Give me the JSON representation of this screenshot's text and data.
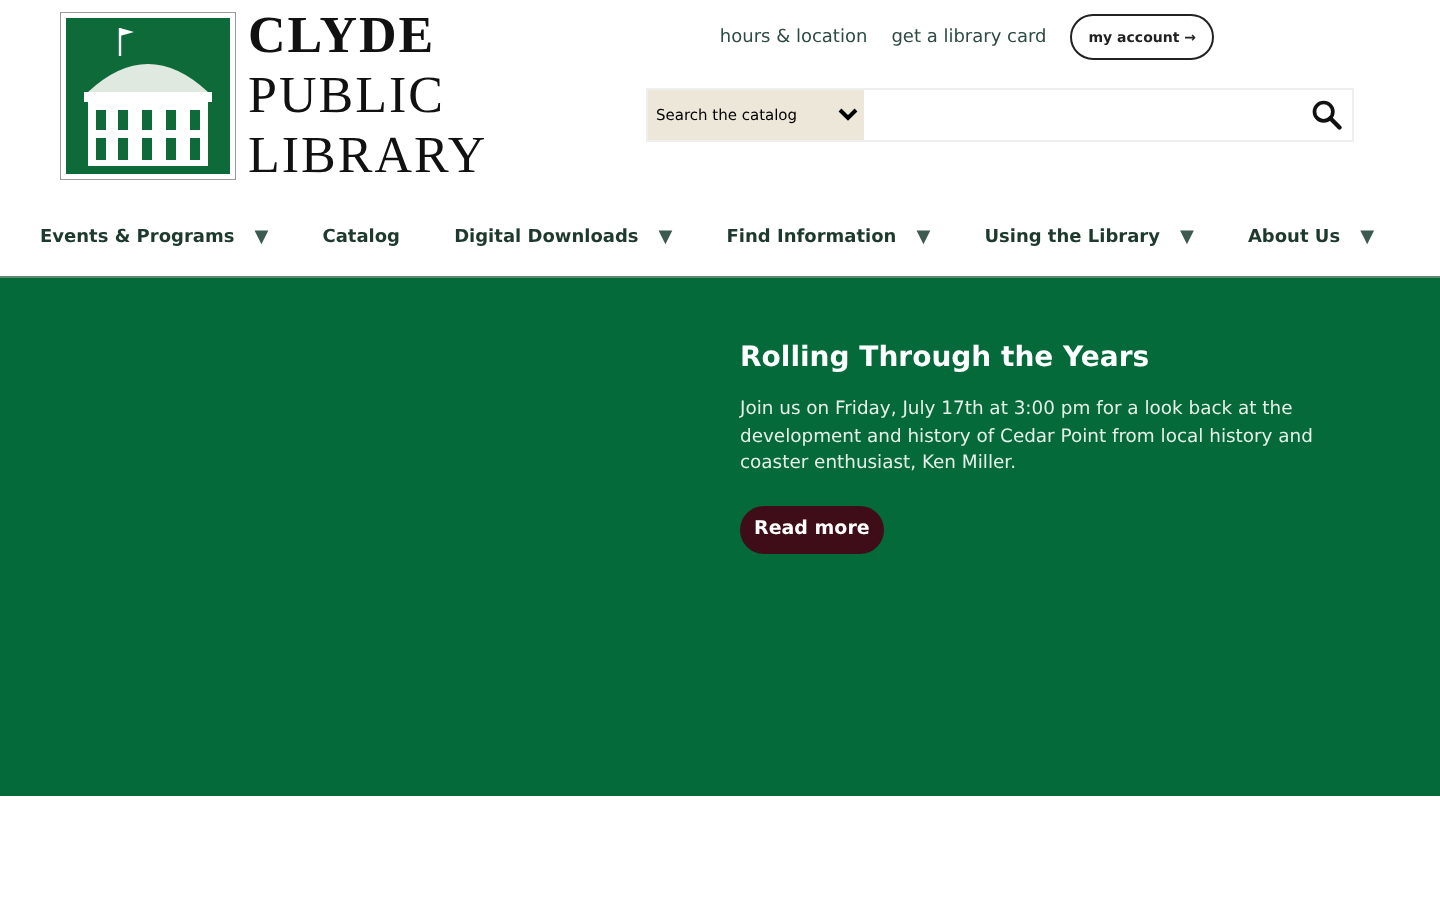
{
  "logo": {
    "lines": [
      "CLYDE",
      "PUBLIC",
      "LIBRARY"
    ]
  },
  "top_links": [
    "hours & location",
    "get a library card"
  ],
  "account_button": {
    "label": "my account",
    "arrow": "→"
  },
  "search": {
    "scope": "Search the catalog"
  },
  "nav": [
    {
      "label": "Events & Programs",
      "caret": "▼"
    },
    {
      "label": "Catalog"
    },
    {
      "label": "Digital Downloads",
      "caret": "▼"
    },
    {
      "label": "Find Information",
      "caret": "▼"
    },
    {
      "label": "Using the Library",
      "caret": "▼"
    },
    {
      "label": "About Us",
      "caret": "▼"
    }
  ],
  "feature": {
    "title": "Rolling Through the Years",
    "text": "Join us on Friday, July 17th at 3:00 pm for a look back at the development and history of Cedar Point from local history and coaster enthusiast, Ken Miller.",
    "button": "Read more"
  }
}
